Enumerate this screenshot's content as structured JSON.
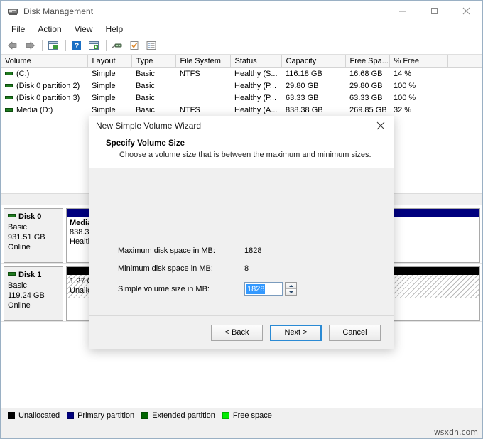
{
  "window": {
    "title": "Disk Management",
    "icon": "disk-management-icon",
    "controls": {
      "minimize": "minimize-icon",
      "maximize": "maximize-icon",
      "close": "close-icon"
    }
  },
  "menu": {
    "items": [
      {
        "label": "File"
      },
      {
        "label": "Action"
      },
      {
        "label": "View"
      },
      {
        "label": "Help"
      }
    ]
  },
  "toolbar": {
    "items": [
      {
        "name": "back-icon"
      },
      {
        "name": "forward-icon"
      },
      {
        "name": "separator"
      },
      {
        "name": "show-hide-console-tree-icon"
      },
      {
        "name": "separator"
      },
      {
        "name": "help-icon"
      },
      {
        "name": "properties-window-icon"
      },
      {
        "name": "separator"
      },
      {
        "name": "rescan-disks-icon"
      },
      {
        "name": "refresh-icon"
      },
      {
        "name": "list-view-icon"
      }
    ]
  },
  "volume_table": {
    "columns": [
      "Volume",
      "Layout",
      "Type",
      "File System",
      "Status",
      "Capacity",
      "Free Spa...",
      "% Free",
      ""
    ],
    "rows": [
      {
        "volume": "(C:)",
        "layout": "Simple",
        "type": "Basic",
        "file_system": "NTFS",
        "status": "Healthy (S...",
        "capacity": "116.18 GB",
        "free_space": "16.68 GB",
        "percent_free": "14 %"
      },
      {
        "volume": "(Disk 0 partition 2)",
        "layout": "Simple",
        "type": "Basic",
        "file_system": "",
        "status": "Healthy (P...",
        "capacity": "29.80 GB",
        "free_space": "29.80 GB",
        "percent_free": "100 %"
      },
      {
        "volume": "(Disk 0 partition 3)",
        "layout": "Simple",
        "type": "Basic",
        "file_system": "",
        "status": "Healthy (P...",
        "capacity": "63.33 GB",
        "free_space": "63.33 GB",
        "percent_free": "100 %"
      },
      {
        "volume": "Media (D:)",
        "layout": "Simple",
        "type": "Basic",
        "file_system": "NTFS",
        "status": "Healthy (A...",
        "capacity": "838.38 GB",
        "free_space": "269.85 GB",
        "percent_free": "32 %"
      }
    ]
  },
  "disks": [
    {
      "name": "Disk 0",
      "type": "Basic",
      "size": "931.51 GB",
      "state": "Online",
      "partitions": [
        {
          "title": "Media (D:)",
          "size": "838.38 GB NTFS",
          "status": "Healthy (Active, Primary Partition)",
          "cap": "primary"
        }
      ]
    },
    {
      "name": "Disk 1",
      "type": "Basic",
      "size": "119.24 GB",
      "state": "Online",
      "partitions": [
        {
          "title": "",
          "size": "1.27 GB",
          "status": "Unallocated",
          "cap": "unallocated"
        }
      ]
    }
  ],
  "legend": {
    "items": [
      {
        "label": "Unallocated",
        "color": "#000000"
      },
      {
        "label": "Primary partition",
        "color": "#00007e"
      },
      {
        "label": "Extended partition",
        "color": "#006400"
      },
      {
        "label": "Free space",
        "color": "#00ec00"
      }
    ]
  },
  "dialog": {
    "title": "New Simple Volume Wizard",
    "close_icon": "close-icon",
    "heading": "Specify Volume Size",
    "subheading": "Choose a volume size that is between the maximum and minimum sizes.",
    "fields": [
      {
        "label": "Maximum disk space in MB:",
        "value": "1828"
      },
      {
        "label": "Minimum disk space in MB:",
        "value": "8"
      }
    ],
    "spinner": {
      "label": "Simple volume size in MB:",
      "value": "1828",
      "up_icon": "spinner-up-icon",
      "down_icon": "spinner-down-icon"
    },
    "buttons": {
      "back": "< Back",
      "next": "Next >",
      "cancel": "Cancel"
    }
  },
  "watermark": "wsxdn.com"
}
